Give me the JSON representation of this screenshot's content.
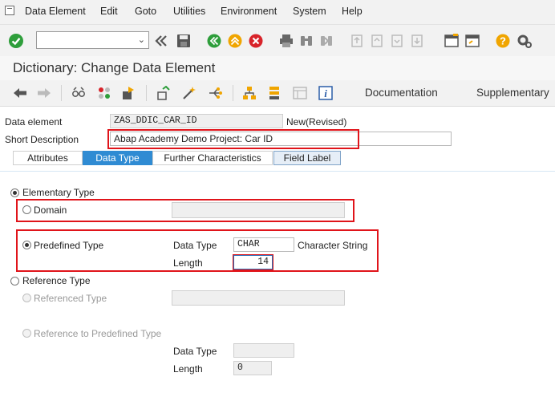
{
  "menu": [
    "Data Element",
    "Edit",
    "Goto",
    "Utilities",
    "Environment",
    "System",
    "Help"
  ],
  "toolbar": {
    "command_field_value": "",
    "icons": [
      "enter-check-icon",
      "fast-back-icon",
      "save-icon",
      "back-icon",
      "exit-icon",
      "cancel-icon",
      "print-icon",
      "find-icon",
      "find-next-icon",
      "first-page-icon",
      "previous-page-icon",
      "next-page-icon",
      "last-page-icon",
      "new-session-icon",
      "shortcut-icon",
      "help-icon",
      "customize-layout-icon"
    ]
  },
  "title": "Dictionary: Change Data Element",
  "app_toolbar": {
    "documentation": "Documentation",
    "supplementary": "Supplementary"
  },
  "header": {
    "data_element_label": "Data element",
    "data_element_value": "ZAS_DDIC_CAR_ID",
    "status": "New(Revised)",
    "short_desc_label": "Short Description",
    "short_desc_value": "Abap Academy Demo Project: Car ID"
  },
  "tabs": [
    {
      "label": "Attributes",
      "active": false
    },
    {
      "label": "Data Type",
      "active": true
    },
    {
      "label": "Further Characteristics",
      "active": false
    },
    {
      "label": "Field Label",
      "active": false
    }
  ],
  "data_type": {
    "elementary_type": "Elementary Type",
    "domain": "Domain",
    "domain_value": "",
    "predefined_type": "Predefined Type",
    "data_type_label": "Data Type",
    "data_type_value": "CHAR",
    "data_type_desc": "Character String",
    "length_label": "Length",
    "length_value": "14",
    "reference_type": "Reference Type",
    "referenced_type": "Referenced Type",
    "referenced_type_value": "",
    "reference_to_predefined": "Reference to Predefined Type",
    "ref_data_type_label": "Data Type",
    "ref_data_type_value": "",
    "ref_length_label": "Length",
    "ref_length_value": "0"
  },
  "colors": {
    "active_tab": "#2f8bd3",
    "highlight_box": "#e0141a",
    "enter_icon": "#2e9e3b",
    "help_icon": "#f0a500"
  }
}
